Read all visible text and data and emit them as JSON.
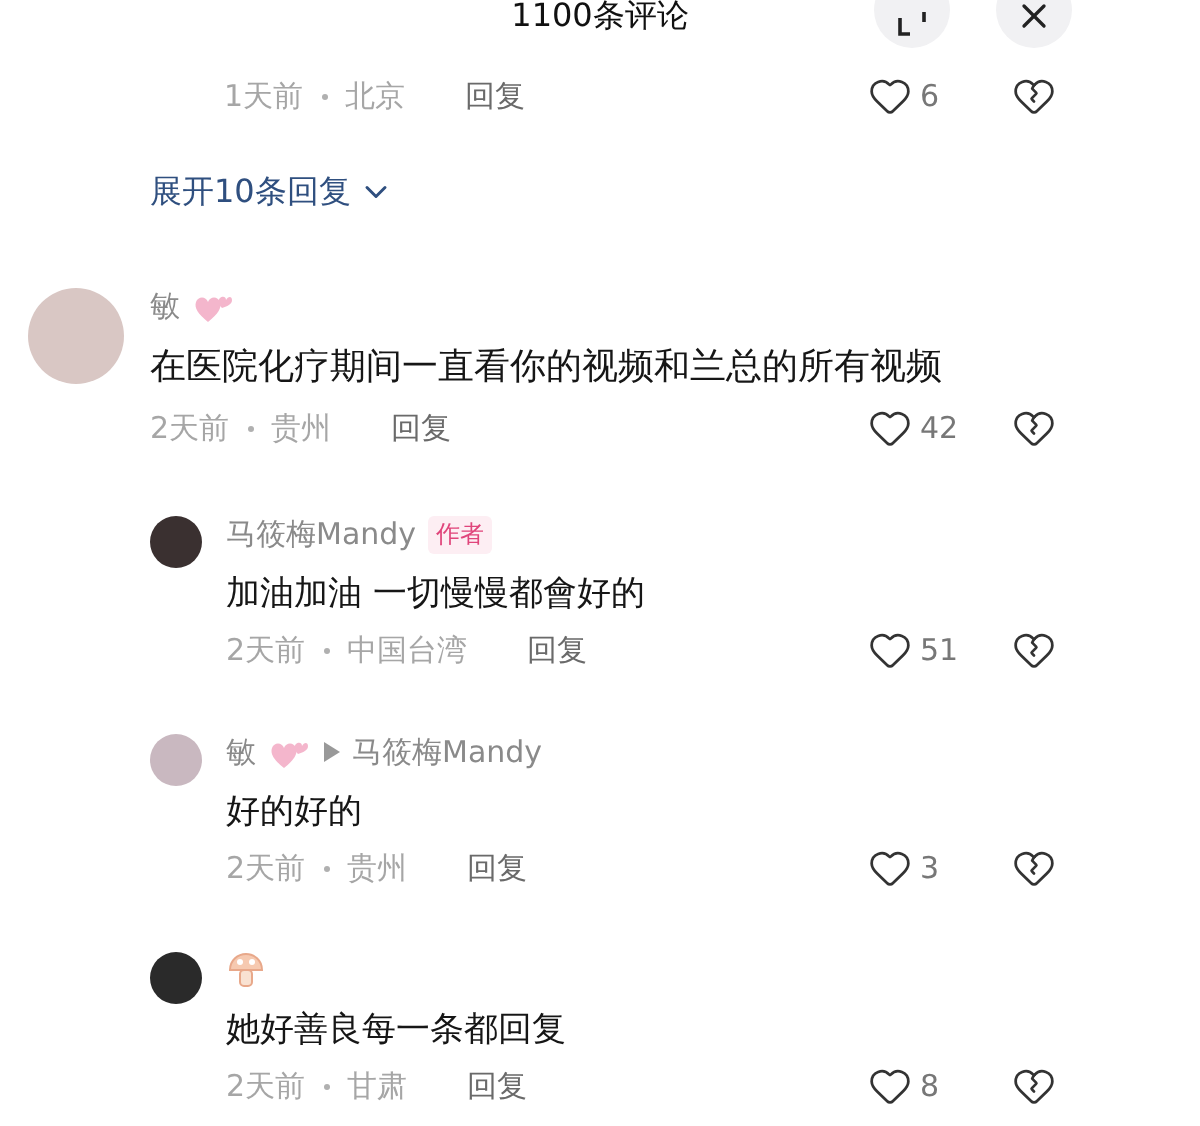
{
  "header": {
    "title": "1100条评论"
  },
  "top_partial": {
    "time": "1天前",
    "location": "北京",
    "reply": "回复",
    "likes": "6"
  },
  "expand_link": "展开10条回复",
  "comments": [
    {
      "author": "敏",
      "author_icon": {
        "kind": "heart"
      },
      "text": "在医院化疗期间一直看你的视频和兰总的所有视频",
      "time": "2天前",
      "location": "贵州",
      "reply": "回复",
      "likes": "42",
      "children": [
        {
          "author": "马筱梅Mandy",
          "badge": "作者",
          "text": "加油加油 一切慢慢都會好的",
          "time": "2天前",
          "location": "中国台湾",
          "reply": "回复",
          "likes": "51"
        },
        {
          "author": "敏",
          "author_icon": {
            "kind": "heart"
          },
          "reply_to": "马筱梅Mandy",
          "text": "好的好的",
          "time": "2天前",
          "location": "贵州",
          "reply": "回复",
          "likes": "3"
        },
        {
          "author_icon": {
            "kind": "mushroom"
          },
          "text": "她好善良每一条都回复",
          "time": "2天前",
          "location": "甘肃",
          "reply": "回复",
          "likes": "8"
        }
      ]
    }
  ]
}
